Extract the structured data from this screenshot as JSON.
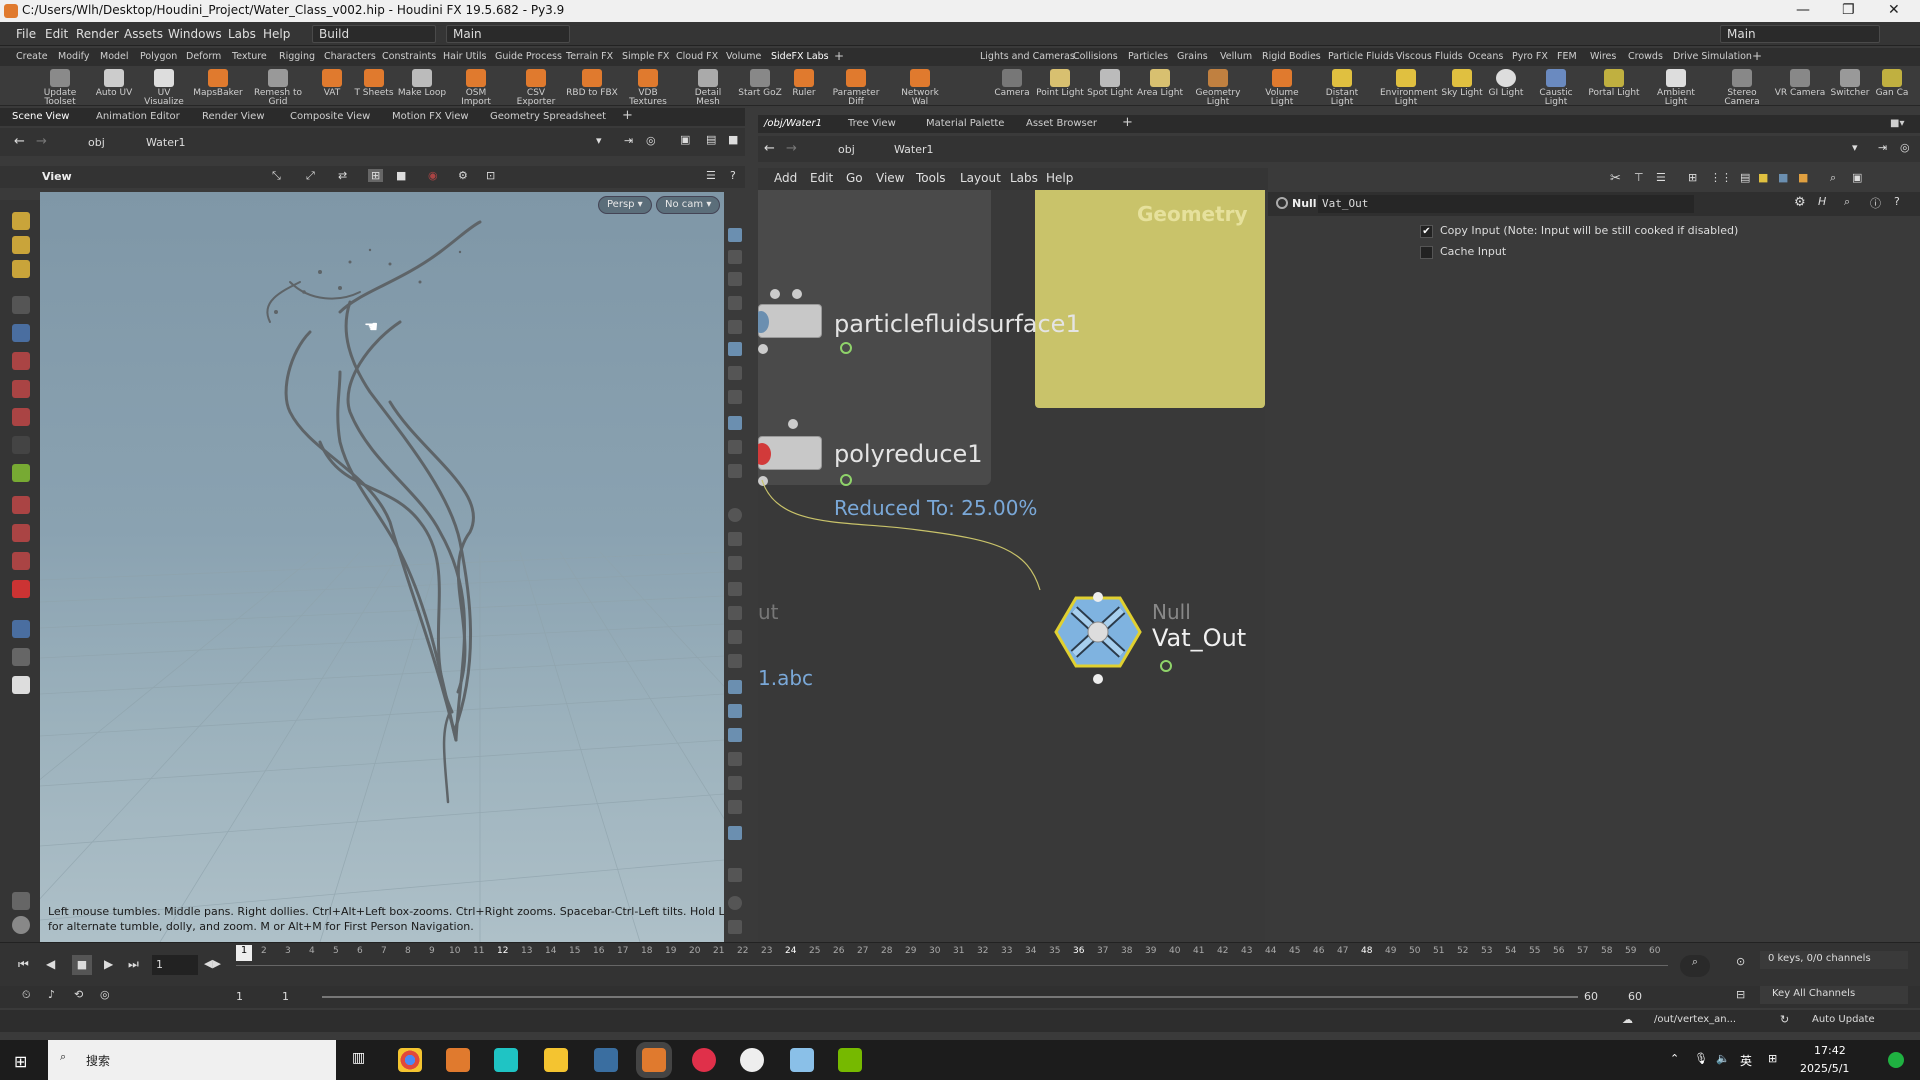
{
  "window": {
    "title": "C:/Users/Wlh/Desktop/Houdini_Project/Water_Class_v002.hip - Houdini FX 19.5.682 - Py3.9",
    "minimize": "—",
    "maximize": "❐",
    "close": "✕"
  },
  "menubar": {
    "items": [
      "File",
      "Edit",
      "Render",
      "Assets",
      "Windows",
      "Labs",
      "Help"
    ],
    "build_combo": "Build",
    "main_combo": "Main",
    "desktop_combo": "Main"
  },
  "shelf_tabs_left": [
    "Create",
    "Modify",
    "Model",
    "Polygon",
    "Deform",
    "Texture",
    "Rigging",
    "Characters",
    "Constraints",
    "Hair Utils",
    "Guide Process",
    "Terrain FX",
    "Simple FX",
    "Cloud FX",
    "Volume",
    "SideFX Labs"
  ],
  "shelf_tabs_right": [
    "Lights and Cameras",
    "Collisions",
    "Particles",
    "Grains",
    "Vellum",
    "Rigid Bodies",
    "Particle Fluids",
    "Viscous Fluids",
    "Oceans",
    "Pyro FX",
    "FEM",
    "Wires",
    "Crowds",
    "Drive Simulation"
  ],
  "shelf_tools_left": [
    "Update Toolset",
    "Auto UV",
    "UV Visualize",
    "MapsBaker",
    "Remesh to Grid",
    "VAT",
    "T Sheets",
    "Make Loop",
    "OSM Import",
    "CSV Exporter",
    "RBD to FBX",
    "VDB Textures",
    "Detail Mesh",
    "Start GoZ",
    "Ruler",
    "Parameter Diff",
    "Network Wal"
  ],
  "shelf_tools_right": [
    "Camera",
    "Point Light",
    "Spot Light",
    "Area Light",
    "Geometry Light",
    "Volume Light",
    "Distant Light",
    "Environment Light",
    "Sky Light",
    "GI Light",
    "Caustic Light",
    "Portal Light",
    "Ambient Light",
    "Stereo Camera",
    "VR Camera",
    "Switcher",
    "Gan Ca"
  ],
  "left_pane": {
    "tabs": [
      "Scene View",
      "Animation Editor",
      "Render View",
      "Composite View",
      "Motion FX View",
      "Geometry Spreadsheet"
    ],
    "path": [
      "obj",
      "Water1"
    ],
    "view_label": "View",
    "persp_button": "Persp ▾",
    "cam_button": "No cam ▾",
    "hint": "Left mouse tumbles. Middle pans. Right dollies. Ctrl+Alt+Left box-zooms. Ctrl+Right zooms. Spacebar-Ctrl-Left tilts. Hold L for alternate tumble, dolly, and zoom.    M or Alt+M for First Person Navigation."
  },
  "right_pane": {
    "tabs": [
      "/obj/Water1",
      "Tree View",
      "Material Palette",
      "Asset Browser"
    ],
    "path": [
      "obj",
      "Water1"
    ],
    "menu": [
      "Add",
      "Edit",
      "Go",
      "View",
      "Tools",
      "Layout",
      "Labs",
      "Help"
    ],
    "nodes": {
      "surface": "particlefluidsurface1",
      "reduce": "polyreduce1",
      "reduce_info": "Reduced To: 25.00%",
      "null_type": "Null",
      "null_name": "Vat_Out",
      "partial_out": "ut",
      "partial_abc": "1.abc",
      "geometry_box": "Geometry"
    },
    "params": {
      "type": "Null",
      "name": "Vat_Out",
      "copy_input": "Copy Input (Note: Input will be still cooked if disabled)",
      "copy_input_checked": true,
      "cache_input": "Cache Input",
      "cache_input_checked": false
    }
  },
  "timeline": {
    "frames": [
      "1",
      "2",
      "3",
      "4",
      "5",
      "6",
      "7",
      "8",
      "9",
      "10",
      "11",
      "12",
      "13",
      "14",
      "15",
      "16",
      "17",
      "18",
      "19",
      "20",
      "21",
      "22",
      "23",
      "24",
      "25",
      "26",
      "27",
      "28",
      "29",
      "30",
      "31",
      "32",
      "33",
      "34",
      "35",
      "36",
      "37",
      "38",
      "39",
      "40",
      "41",
      "42",
      "43",
      "44",
      "45",
      "46",
      "47",
      "48",
      "49",
      "50",
      "51",
      "52",
      "53",
      "54",
      "55",
      "56",
      "57",
      "58",
      "59",
      "60"
    ],
    "current_frame": "1",
    "range_start": "1",
    "range_start2": "1",
    "range_end": "60",
    "range_end2": "60",
    "keys_label": "0 keys, 0/0 channels",
    "key_all": "Key All Channels"
  },
  "statusbar": {
    "path": "/out/vertex_an...",
    "auto_update": "Auto Update"
  },
  "taskbar": {
    "search": "搜索",
    "time": "17:42",
    "date": "2025/5/1",
    "ime": "英"
  },
  "colors": {
    "accent_orange": "#e07a2e",
    "geometry_box": "#c9c36a",
    "info_text": "#7aa8d8",
    "null_node": "#7fb3e0"
  }
}
